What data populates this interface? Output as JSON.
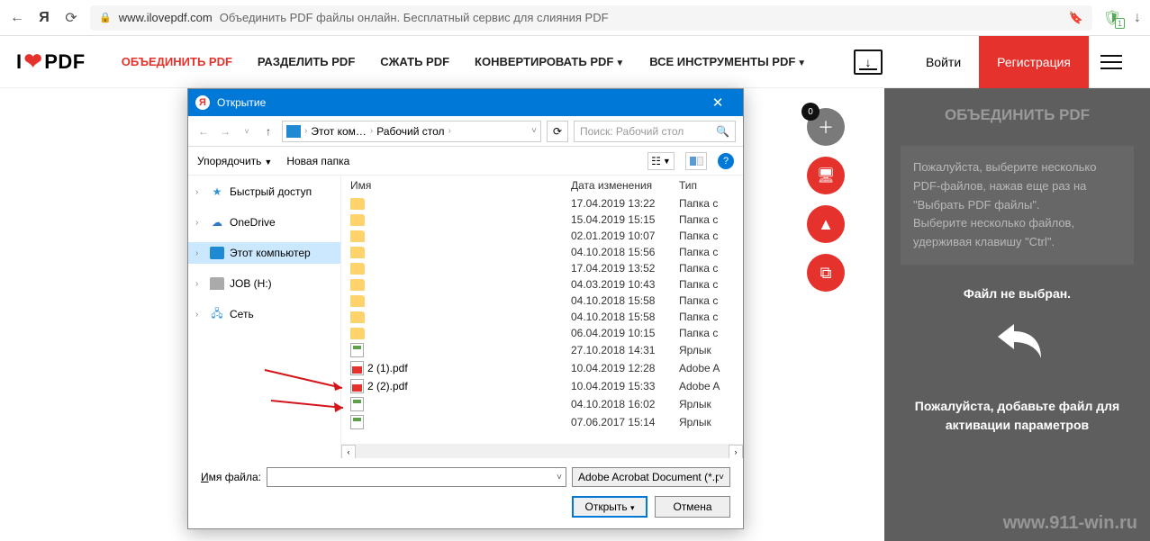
{
  "browser": {
    "url_host": "www.ilovepdf.com",
    "url_title": "Объединить PDF файлы онлайн. Бесплатный сервис для слияния PDF",
    "ext_badge": "1"
  },
  "header": {
    "logo_left": "I",
    "logo_right": "PDF",
    "nav": {
      "merge": "ОБЪЕДИНИТЬ PDF",
      "split": "РАЗДЕЛИТЬ PDF",
      "compress": "СЖАТЬ PDF",
      "convert": "КОНВЕРТИРОВАТЬ PDF",
      "all": "ВСЕ ИНСТРУМЕНТЫ PDF"
    },
    "login": "Войти",
    "register": "Регистрация"
  },
  "fab": {
    "badge": "0"
  },
  "right_panel": {
    "title": "ОБЪЕДИНИТЬ PDF",
    "info1": "Пожалуйста, выберите несколько PDF-файлов, нажав еще раз на \"Выбрать PDF файлы\".",
    "info2": "Выберите несколько файлов, удерживая клавишу \"Ctrl\".",
    "no_file": "Файл не выбран.",
    "add_msg": "Пожалуйста, добавьте файл для активации параметров",
    "watermark": "www.911-win.ru"
  },
  "dialog": {
    "title": "Открытие",
    "bc1": "Этот ком…",
    "bc2": "Рабочий стол",
    "search_placeholder": "Поиск: Рабочий стол",
    "organize": "Упорядочить",
    "new_folder": "Новая папка",
    "help_label": "?",
    "sidebar": {
      "quick": "Быстрый доступ",
      "onedrive": "OneDrive",
      "thispc": "Этот компьютер",
      "job": "JOB (H:)",
      "network": "Сеть"
    },
    "columns": {
      "name": "Имя",
      "date": "Дата изменения",
      "type": "Тип"
    },
    "files": [
      {
        "name": "",
        "date": "17.04.2019 13:22",
        "type": "Папка с",
        "icon": "folder"
      },
      {
        "name": "",
        "date": "15.04.2019 15:15",
        "type": "Папка с",
        "icon": "folder"
      },
      {
        "name": "",
        "date": "02.01.2019 10:07",
        "type": "Папка с",
        "icon": "folder"
      },
      {
        "name": "",
        "date": "04.10.2018 15:56",
        "type": "Папка с",
        "icon": "folder"
      },
      {
        "name": "",
        "date": "17.04.2019 13:52",
        "type": "Папка с",
        "icon": "folder"
      },
      {
        "name": "",
        "date": "04.03.2019 10:43",
        "type": "Папка с",
        "icon": "folder"
      },
      {
        "name": "",
        "date": "04.10.2018 15:58",
        "type": "Папка с",
        "icon": "folder"
      },
      {
        "name": "",
        "date": "04.10.2018 15:58",
        "type": "Папка с",
        "icon": "folder"
      },
      {
        "name": "",
        "date": "06.04.2019 10:15",
        "type": "Папка с",
        "icon": "folder"
      },
      {
        "name": "",
        "date": "27.10.2018 14:31",
        "type": "Ярлык",
        "icon": "shortcut"
      },
      {
        "name": "2 (1).pdf",
        "date": "10.04.2019 12:28",
        "type": "Adobe A",
        "icon": "pdf"
      },
      {
        "name": "2 (2).pdf",
        "date": "10.04.2019 15:33",
        "type": "Adobe A",
        "icon": "pdf"
      },
      {
        "name": "",
        "date": "04.10.2018 16:02",
        "type": "Ярлык",
        "icon": "shortcut"
      },
      {
        "name": "",
        "date": "07.06.2017 15:14",
        "type": "Ярлык",
        "icon": "shortcut"
      }
    ],
    "filename_label_u": "И",
    "filename_label_r": "мя файла:",
    "file_type_filter": "Adobe Acrobat Document (*.p…",
    "open_btn": "Открыть",
    "cancel_btn": "Отмена"
  }
}
